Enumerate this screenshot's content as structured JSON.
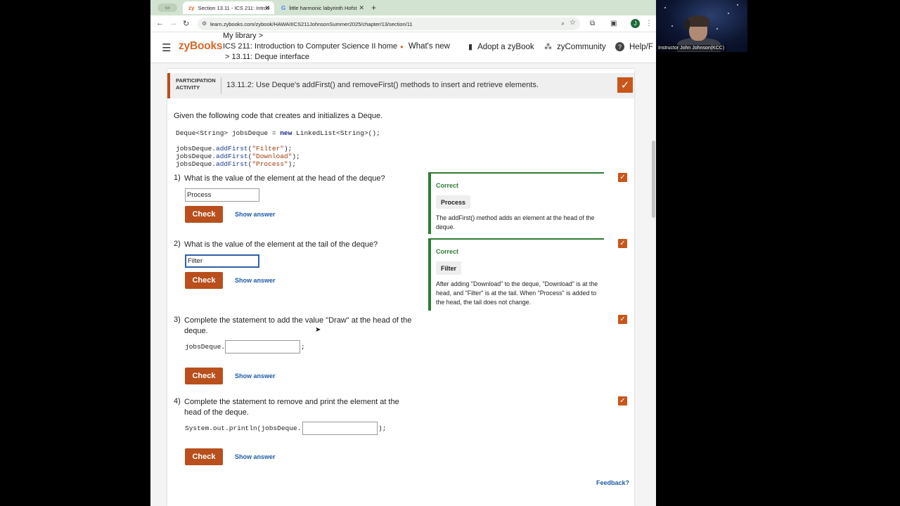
{
  "browser": {
    "tabs": [
      {
        "favicon": "zy",
        "title": "Section 13.11 - ICS 211: Introd",
        "active": true
      },
      {
        "favicon": "G",
        "title": "little harmonic labyrinth Hofst",
        "active": false
      }
    ],
    "new_tab": "+",
    "url": "learn.zybooks.com/zybook/HAWAIIICS211JohnsonSummer2025/chapter/13/section/11",
    "profile_initial": "J"
  },
  "header": {
    "logo": "zyBooks",
    "breadcrumb": {
      "library": "My library >",
      "course": "ICS 211: Introduction to Computer Science II home",
      "section": "> 13.11: Deque interface"
    },
    "nav": {
      "whats_new": "What's new",
      "adopt": "Adopt a zyBook",
      "community": "zyCommunity",
      "help": "Help/F"
    }
  },
  "activity": {
    "label_line1": "PARTICIPATION",
    "label_line2": "ACTIVITY",
    "title": "13.11.2: Use Deque's addFirst() and removeFirst() methods to insert and retrieve elements.",
    "intro": "Given the following code that creates and initializes a Deque.",
    "feedback_link": "Feedback?"
  },
  "questions": {
    "q1": {
      "number": "1)",
      "text": "What is the value of the element at the head of the deque?",
      "input_value": "Process",
      "check_label": "Check",
      "show_answer": "Show answer",
      "feedback": {
        "status": "Correct",
        "answer": "Process",
        "explanation": "The addFirst() method adds an element at the head of the deque."
      }
    },
    "q2": {
      "number": "2)",
      "text": "What is the value of the element at the tail of the deque?",
      "input_value": "Filter",
      "check_label": "Check",
      "show_answer": "Show answer",
      "feedback": {
        "status": "Correct",
        "answer": "Filter",
        "explanation": "After adding \"Download\" to the deque, \"Download\" is at the head, and \"Filter\" is at the tail. When \"Process\" is added to the head, the tail does not change."
      }
    },
    "q3": {
      "number": "3)",
      "text": "Complete the statement to add the value \"Draw\" at the head of the deque.",
      "prefix": "jobsDeque.",
      "suffix": ";",
      "input_value": "",
      "check_label": "Check",
      "show_answer": "Show answer"
    },
    "q4": {
      "number": "4)",
      "text": "Complete the statement to remove and print the element at the head of the deque.",
      "prefix": "System.out.println(jobsDeque.",
      "suffix": ");",
      "input_value": "",
      "check_label": "Check",
      "show_answer": "Show answer"
    }
  },
  "webcam": {
    "name_label": "Instructor John Johnson(KCC)"
  },
  "colors": {
    "accent": "#b84f1c",
    "check_orange": "#c8561a",
    "correct_green": "#2e7d32",
    "link_blue": "#1f5aa6",
    "logo_orange": "#d6692b"
  }
}
